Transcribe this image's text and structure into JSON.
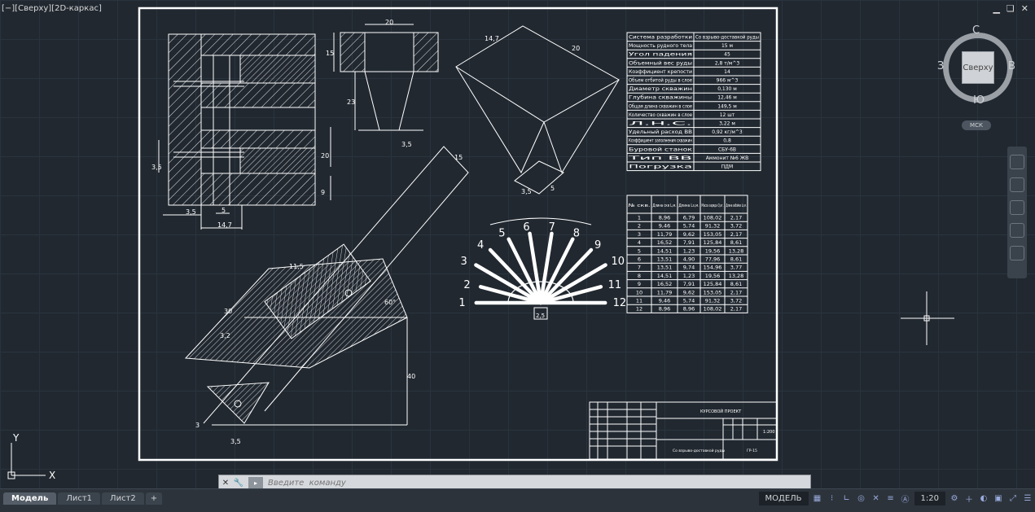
{
  "viewport": {
    "label": "[−][Сверху][2D-каркас]"
  },
  "window_controls": {
    "minimize": "▁",
    "restore": "❏",
    "close": "✕"
  },
  "viewcube": {
    "face": "Сверху",
    "north": "С",
    "south": "Ю",
    "west": "З",
    "east": "В",
    "ucs_label": "МСК"
  },
  "ucs_icon": {
    "x_label": "X",
    "y_label": "Y"
  },
  "drawing": {
    "dims": {
      "d20_top": "20",
      "d15": "15",
      "d23": "23",
      "d3_5a": "3,5",
      "d14_7a": "14,7",
      "d20_right": "20",
      "d3_5_left": "3,5",
      "d20_side": "20",
      "d9": "9",
      "d3_5_bottom": "3,5",
      "d5": "5",
      "d14_7_bottom": "14,7",
      "d14_7_funnel": "14,7",
      "d20_funnel": "20",
      "d3_5_funnel": "3,5",
      "d5_funnel": "5",
      "d15_slope": "15",
      "d11_5": "11,5",
      "d30": "30",
      "d3_2": "3,2",
      "d60": "60°",
      "d40": "40",
      "d3": "3",
      "d3_5_base": "3,5",
      "d2_5": "2,5"
    },
    "fan_numbers": [
      "1",
      "2",
      "3",
      "4",
      "5",
      "6",
      "7",
      "8",
      "9",
      "10",
      "11",
      "12"
    ],
    "params": [
      [
        "Система разработки",
        "Со взрыво-доставкой руды"
      ],
      [
        "Мощность рудного тела",
        "15 м"
      ],
      [
        "Угол падения",
        "45"
      ],
      [
        "Объемный вес руды",
        "2,8 т/м^3"
      ],
      [
        "Коэффициент крепости",
        "14"
      ],
      [
        "Объем отбитой руды в слое",
        "966 м^3"
      ],
      [
        "Диаметр скважин",
        "0,130 м"
      ],
      [
        "Глубина скважины",
        "12,46 м"
      ],
      [
        "Общая длина скважин в слое",
        "149,5 м"
      ],
      [
        "Количество скважин в слое",
        "12 шт"
      ],
      [
        "Л.Н.С.",
        "3,22 м"
      ],
      [
        "Удельный расход ВВ",
        "0,92 кг/м^3"
      ],
      [
        "Коэффициент заполнения скважин",
        "0,8"
      ],
      [
        "Буровой станок",
        "СБУ-6В"
      ],
      [
        "Тип ВВ",
        "Аммонит №6 ЖВ"
      ],
      [
        "Погрузка",
        "ПДМ"
      ]
    ],
    "wells_header": [
      "№ скв.",
      "Длина скв L,м.",
      "Длина Lз,м.",
      "Масса заряда Q,кг.",
      "Длина забойки Lз,м."
    ],
    "wells": [
      [
        "1",
        "8,96",
        "6,79",
        "108,02",
        "2,17"
      ],
      [
        "2",
        "9,46",
        "5,74",
        "91,32",
        "3,72"
      ],
      [
        "3",
        "11,79",
        "9,62",
        "153,05",
        "2,17"
      ],
      [
        "4",
        "16,52",
        "7,91",
        "125,84",
        "8,61"
      ],
      [
        "5",
        "14,51",
        "1,23",
        "19,56",
        "13,28"
      ],
      [
        "6",
        "13,51",
        "4,90",
        "77,96",
        "8,61"
      ],
      [
        "7",
        "13,51",
        "9,74",
        "154,96",
        "3,77"
      ],
      [
        "8",
        "14,51",
        "1,23",
        "19,56",
        "13,28"
      ],
      [
        "9",
        "16,52",
        "7,91",
        "125,84",
        "8,61"
      ],
      [
        "10",
        "11,79",
        "9,62",
        "153,05",
        "2,17"
      ],
      [
        "11",
        "9,46",
        "5,74",
        "91,32",
        "3,72"
      ],
      [
        "12",
        "8,96",
        "8,96",
        "108,02",
        "2,17"
      ]
    ],
    "title_block": {
      "project": "КУРСОВОЙ ПРОЕКТ",
      "scale": "1:200",
      "description": "Со взрыво-доставкой руды",
      "group": "ГР-15"
    }
  },
  "command_line": {
    "placeholder": "Введите  команду",
    "close": "✕",
    "settings": "🔧"
  },
  "layout_tabs": [
    "Модель",
    "Лист1",
    "Лист2"
  ],
  "statusbar": {
    "model_label": "МОДЕЛЬ",
    "scale": "1:20"
  }
}
